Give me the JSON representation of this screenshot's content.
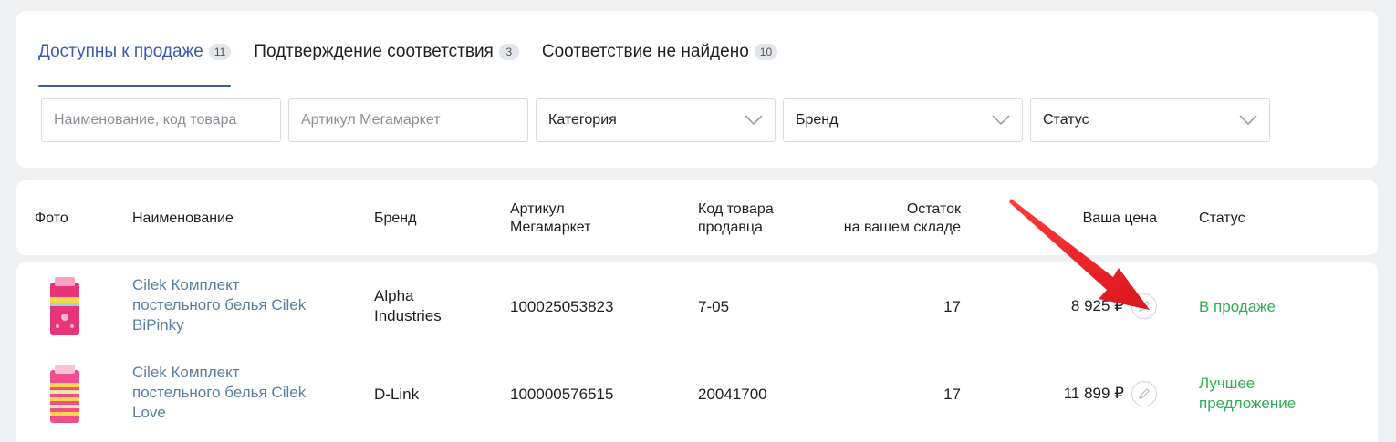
{
  "tabs": [
    {
      "label": "Доступны к продаже",
      "count": "11",
      "active": true
    },
    {
      "label": "Подтверждение соответствия",
      "count": "3",
      "active": false
    },
    {
      "label": "Соответствие не найдено",
      "count": "10",
      "active": false
    }
  ],
  "filters": {
    "name_placeholder": "Наименование, код товара",
    "article_placeholder": "Артикул Мегамаркет",
    "category": "Категория",
    "brand": "Бренд",
    "status": "Статус"
  },
  "columns": {
    "photo": "Фото",
    "name": "Наименование",
    "brand": "Бренд",
    "article_l1": "Артикул",
    "article_l2": "Мегамаркет",
    "seller_code_l1": "Код товара",
    "seller_code_l2": "продавца",
    "stock_l1": "Остаток",
    "stock_l2": "на вашем складе",
    "price": "Ваша цена",
    "status": "Статус"
  },
  "rows": [
    {
      "name_l1": "Cilek Комплект",
      "name_l2": "постельного белья Cilek",
      "name_l3": "BiPinky",
      "brand_l1": "Alpha",
      "brand_l2": "Industries",
      "article": "100025053823",
      "seller_code": "7-05",
      "stock": "17",
      "price": "8 925 ₽",
      "status_l1": "В продаже",
      "status_l2": ""
    },
    {
      "name_l1": "Cilek Комплект",
      "name_l2": "постельного белья Cilek",
      "name_l3": "Love",
      "brand_l1": "D-Link",
      "brand_l2": "",
      "article": "100000576515",
      "seller_code": "20041700",
      "stock": "17",
      "price": "11 899 ₽",
      "status_l1": "Лучшее",
      "status_l2": "предложение"
    }
  ],
  "colors": {
    "accent": "#3b5bb0",
    "link": "#5a7ea3",
    "status_green": "#2fae54",
    "arrow": "#e8202a"
  },
  "icons": [
    "chevron-down-icon",
    "pencil-icon",
    "product-thumbnail",
    "red-arrow-annotation"
  ]
}
